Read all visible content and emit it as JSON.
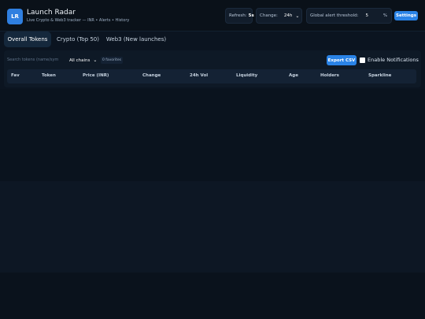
{
  "header": {
    "logo": "LR",
    "title": "Launch Radar",
    "subtitle": "Live Crypto & Web3 tracker — INR • Alerts • History",
    "refresh": {
      "label": "Refresh:",
      "value": "5s"
    },
    "change": {
      "label": "Change:",
      "selected": "24h"
    },
    "threshold": {
      "label": "Global alert threshold:",
      "value": "5",
      "unit": "%"
    },
    "settings_label": "Settings"
  },
  "tabs": [
    {
      "label": "Overall Tokens",
      "active": true
    },
    {
      "label": "Crypto (Top 50)",
      "active": false
    },
    {
      "label": "Web3 (New launches)",
      "active": false
    }
  ],
  "toolbar": {
    "search_placeholder": "Search tokens (name/sym",
    "chain_selected": "All chains",
    "favorites_label": "0 favorites",
    "export_label": "Export CSV",
    "notifications_label": "Enable Notifications",
    "notifications_checked": false
  },
  "table": {
    "columns": [
      "Fav",
      "Token",
      "Price (INR)",
      "Change",
      "24h Vol",
      "Liquidity",
      "Age",
      "Holders",
      "Sparkline"
    ],
    "rows": []
  },
  "colors": {
    "accent": "#2a83e6",
    "background": "#0b1420",
    "panel": "#0e1926"
  }
}
